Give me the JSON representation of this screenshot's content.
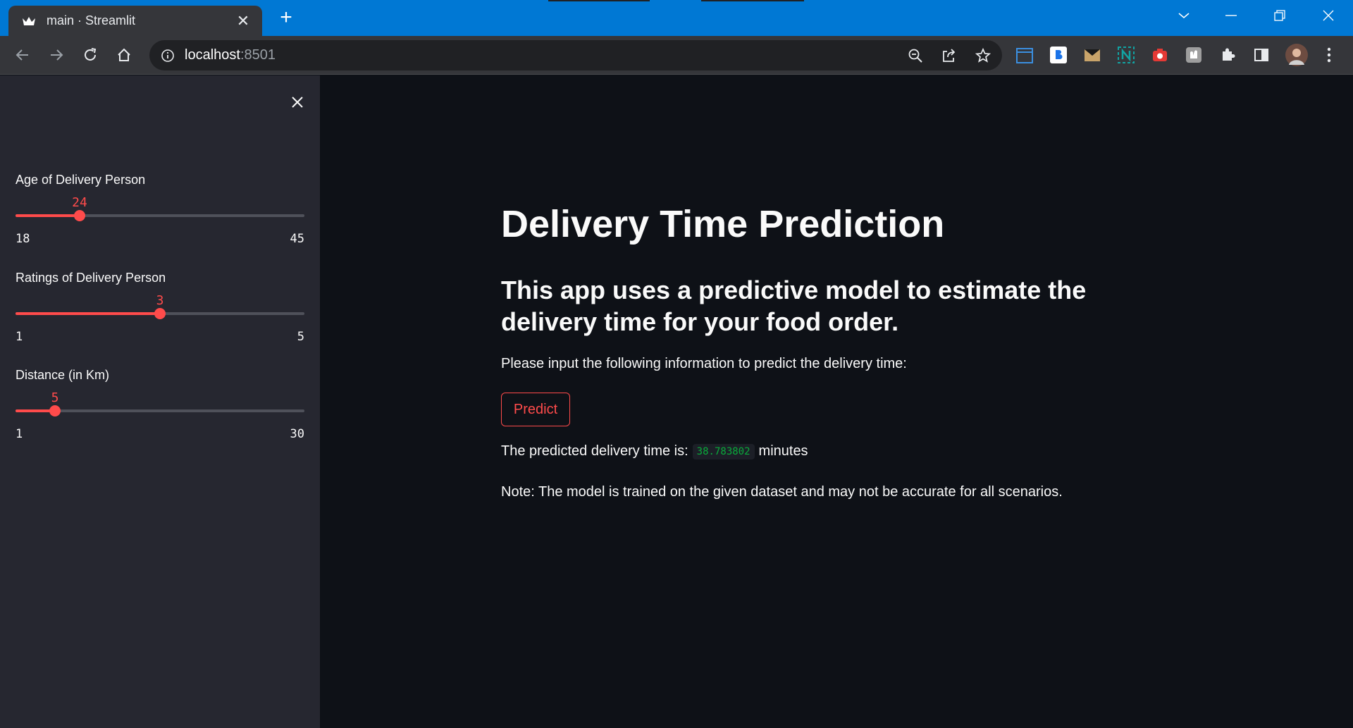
{
  "browser": {
    "tab_title": "main · Streamlit",
    "url_host": "localhost",
    "url_port": ":8501"
  },
  "sidebar": {
    "sliders": [
      {
        "label": "Age of Delivery Person",
        "value": "24",
        "min": "18",
        "max": "45"
      },
      {
        "label": "Ratings of Delivery Person",
        "value": "3",
        "min": "1",
        "max": "5"
      },
      {
        "label": "Distance (in Km)",
        "value": "5",
        "min": "1",
        "max": "30"
      }
    ]
  },
  "main": {
    "title": "Delivery Time Prediction",
    "subtitle": "This app uses a predictive model to estimate the delivery time for your food order.",
    "instructions": "Please input the following information to predict the delivery time:",
    "predict_label": "Predict",
    "result_prefix": "The predicted delivery time is:",
    "result_value": "38.783802",
    "result_suffix": "minutes",
    "note": "Note: The model is trained on the given dataset and may not be accurate for all scenarios."
  },
  "colors": {
    "accent": "#ff4b4b",
    "background": "#0e1117",
    "sidebar": "#262730",
    "code_text": "#09ab3b"
  }
}
